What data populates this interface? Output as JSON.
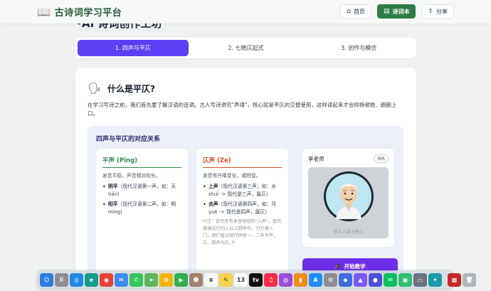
{
  "header": {
    "brand_title": "古诗词学习平台",
    "nav": [
      {
        "label": "首页",
        "icon": "home-icon",
        "active": false
      },
      {
        "label": "诗词本",
        "icon": "book-icon",
        "active": true
      },
      {
        "label": "分享",
        "icon": "share-icon",
        "active": false
      }
    ]
  },
  "page": {
    "title": "AI 诗词创作工坊"
  },
  "steps": [
    {
      "label": "1. 四声与平仄",
      "active": true
    },
    {
      "label": "2. 七绝仄起式",
      "active": false
    },
    {
      "label": "3. 创作与模仿",
      "active": false
    }
  ],
  "lesson": {
    "heading": "什么是平仄?",
    "intro": "在学习写诗之前，我们首先要了解汉语的音调。古人写诗讲究\"声律\"，核心就是平仄的交替使用，这样读起来才会抑扬顿挫、朗朗上口。",
    "panel_title": "四声与平仄的对应关系",
    "ping": {
      "title": "平声 (Ping)",
      "desc": "发音平稳，声音相对较长。",
      "items": [
        {
          "term": "阴平",
          "text": "（现代汉语第一声，如：天 tiān)"
        },
        {
          "term": "阳平",
          "text": "（现代汉语第二声，如：明 míng)"
        }
      ]
    },
    "ze": {
      "title": "仄声 (Ze)",
      "desc": "发音有升降变化，或短促。",
      "items": [
        {
          "term": "上声",
          "text": "（现代汉语第三声，如：水 shuǐ -> 现代是三声，属仄)"
        },
        {
          "term": "去声",
          "text": "（现代汉语第四声，如：月 yuè -> 现代是四声，属仄)"
        }
      ],
      "note": "*(注：古代还有发音短促的\"入声\"，现代普通话已归入以上四声中。为方便入门，我们暂以现代拼音一、二声为平，三、四声为仄。)*"
    },
    "teacher": {
      "name": "李老师",
      "status": "待机",
      "caption": "数字人演示模式"
    },
    "start_button": "开始教学"
  },
  "dock": [
    {
      "icon": "finder-icon",
      "color": "#2a7de1",
      "glyph": "☺"
    },
    {
      "icon": "launchpad-icon",
      "color": "#8e8e93",
      "glyph": "⠿"
    },
    {
      "icon": "safari-icon",
      "color": "#1e88e5",
      "glyph": "◎"
    },
    {
      "icon": "edge-icon",
      "color": "#0f9d8c",
      "glyph": "e"
    },
    {
      "icon": "chrome-icon",
      "color": "#e94235",
      "glyph": "◉"
    },
    {
      "icon": "mail-icon",
      "color": "#3d8bf2",
      "glyph": "✉"
    },
    {
      "icon": "messages-icon",
      "color": "#34c759",
      "glyph": "✆"
    },
    {
      "icon": "maps-icon",
      "color": "#5cb85c",
      "glyph": "➤"
    },
    {
      "icon": "photos-icon",
      "color": "#f4b400",
      "glyph": "✿"
    },
    {
      "icon": "facetime-icon",
      "color": "#2fb24c",
      "glyph": "▶"
    },
    {
      "icon": "contacts-icon",
      "color": "#a0826d",
      "glyph": "☻"
    },
    {
      "icon": "reminders-icon",
      "color": "#f7f7f7",
      "glyph": "≡"
    },
    {
      "icon": "notes-icon",
      "color": "#f8d24a",
      "glyph": "✎"
    },
    {
      "icon": "calendar-icon",
      "color": "#ffffff",
      "glyph": "13"
    },
    {
      "icon": "tv-icon",
      "color": "#111111",
      "glyph": "tv"
    },
    {
      "icon": "music-icon",
      "color": "#fa2d48",
      "glyph": "♫"
    },
    {
      "icon": "podcasts-icon",
      "color": "#9b4dd8",
      "glyph": "◍"
    },
    {
      "icon": "books-icon",
      "color": "#f28c18",
      "glyph": "▮"
    },
    {
      "icon": "appstore-icon",
      "color": "#1c8ef9",
      "glyph": "A"
    },
    {
      "icon": "settings-icon",
      "color": "#8e8e93",
      "glyph": "⚙"
    },
    {
      "icon": "app-blue-icon",
      "color": "#3a6fe0",
      "glyph": "◆"
    },
    {
      "icon": "app-purple-icon",
      "color": "#7a5af5",
      "glyph": "▲"
    },
    {
      "icon": "app-indigo-icon",
      "color": "#4a4fd6",
      "glyph": "●"
    },
    {
      "icon": "wechat-icon",
      "color": "#07c160",
      "glyph": "✉"
    },
    {
      "icon": "app-green-icon",
      "color": "#2fbf71",
      "glyph": "▣"
    },
    {
      "icon": "app-gray-icon",
      "color": "#6b7280",
      "glyph": "▭"
    },
    {
      "icon": "app-teal-icon",
      "color": "#1b9aaa",
      "glyph": "✦"
    },
    {
      "icon": "app-red-icon",
      "color": "#c62828",
      "glyph": "▩"
    },
    {
      "icon": "trash-icon",
      "color": "#b0b6bd",
      "glyph": "🗑"
    }
  ],
  "colors": {
    "brand": "#235c36",
    "nav_active": "#2e7d45",
    "step_active": "#5b3ff2",
    "start_button": "#6d2ee8",
    "ping_accent": "#2f8a47",
    "ze_accent": "#d94f21"
  }
}
